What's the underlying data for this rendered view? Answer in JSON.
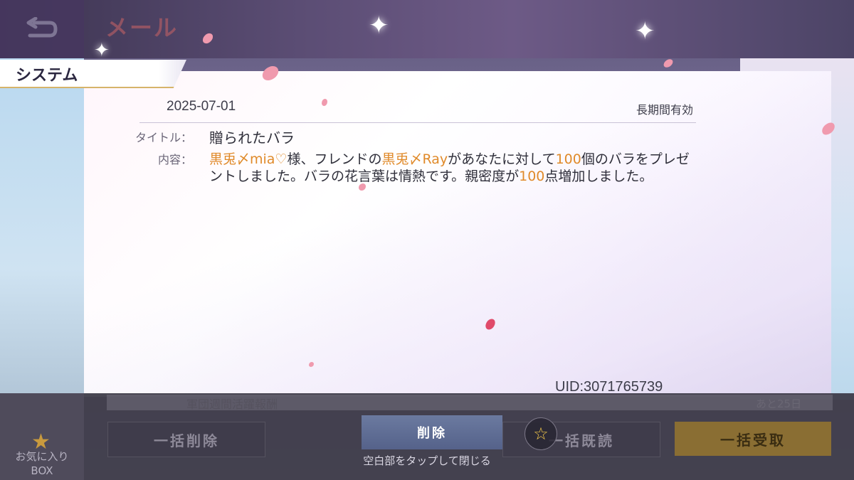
{
  "header": {
    "title": "メール",
    "back_icon": "back-arrow-icon"
  },
  "tabs": {
    "system_label": "システム"
  },
  "mail": {
    "date": "2025-07-01",
    "validity": "長期間有効",
    "title_label": "タイトル：",
    "title_value": "贈られたバラ",
    "body_label": "内容：",
    "body_parts": {
      "sender_name": "黒兎〆mia♡",
      "text1": "様、フレンドの",
      "friend_name": "黒兎〆Ray",
      "text2": "があなたに対して",
      "rose_count": "100",
      "text3": "個のバラをプレゼントしました。バラの花言葉は情熱です。親密度が",
      "intimacy": "100",
      "text4": "点増加しました。"
    },
    "uid": "UID:3071765739"
  },
  "list_behind": {
    "item_text": "軍団週間活躍報酬",
    "item_remaining": "あと25日"
  },
  "favorites": {
    "label_line1": "お気に入り",
    "label_line2": "BOX",
    "icon": "star-icon"
  },
  "actions": {
    "bulk_delete": "一括削除",
    "delete": "削除",
    "bulk_read": "一括既読",
    "bulk_receive": "一括受取",
    "favorite_icon": "star-outline-icon",
    "close_hint": "空白部をタップして閉じる"
  },
  "colors": {
    "highlight": "#e08a2a",
    "accent_gold": "#8a6e33",
    "delete_blue": "#55628a"
  }
}
